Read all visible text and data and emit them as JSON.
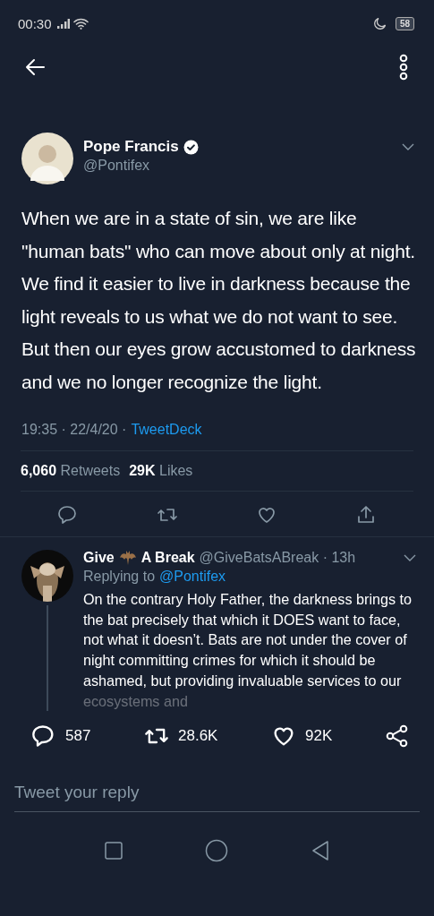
{
  "status_bar": {
    "time": "00:30",
    "battery": "58"
  },
  "tweet": {
    "author": "Pope Francis",
    "verified": true,
    "handle": "@Pontifex",
    "text": "When we are in a state of sin, we are like \"human bats\" who can move about only at night. We find it easier to live in darkness because the light reveals to us what we do not want to see. But then our eyes grow accustomed to darkness and we no longer recognize the light.",
    "meta": "19:35 · 22/4/20 ·",
    "source": "TweetDeck",
    "stats": [
      "**6,060** Retweets",
      "**29K** Likes"
    ]
  },
  "reply": {
    "name_before": "Give",
    "name_after": "A Break",
    "handle": "@GiveBatsABreak · 13h",
    "replying_label": "Replying to",
    "replying_to": "@Pontifex",
    "text": "On the contrary Holy Father, the darkness brings to the bat precisely that which it DOES want to face, not what it doesn’t. Bats are not under the cover of night committing crimes for which it should be ashamed, but providing invaluable services to our ecosystems and",
    "replies": "587",
    "retweets": "28.6K",
    "likes": "92K"
  },
  "reply_field": {
    "placeholder": "Tweet your reply"
  }
}
